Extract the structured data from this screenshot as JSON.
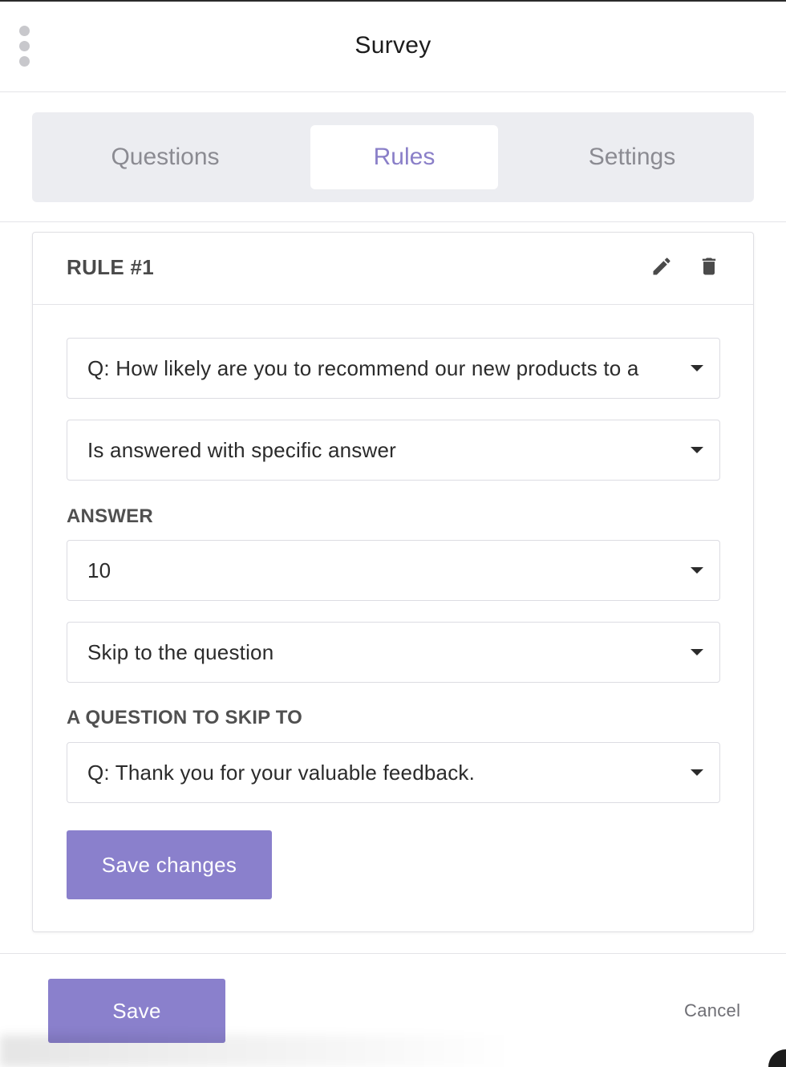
{
  "header": {
    "title": "Survey",
    "menu_icon": "kebab-vertical-icon"
  },
  "tabs": [
    {
      "label": "Questions",
      "active": false
    },
    {
      "label": "Rules",
      "active": true
    },
    {
      "label": "Settings",
      "active": false
    }
  ],
  "rule": {
    "title": "RULE #1",
    "edit_icon": "pencil-icon",
    "delete_icon": "trash-icon",
    "question_select": "Q: How likely are you to recommend our new products to a",
    "condition_select": "Is answered with specific answer",
    "answer_label": "ANSWER",
    "answer_select": "10",
    "action_select": "Skip to the question",
    "skip_to_label": "A QUESTION TO SKIP TO",
    "skip_to_select": "Q: Thank you for your valuable feedback.",
    "save_changes_label": "Save changes"
  },
  "footer": {
    "save_label": "Save",
    "cancel_label": "Cancel"
  },
  "colors": {
    "accent": "#8a80cc",
    "tab_bar_bg": "#ecedf1",
    "active_tab_text": "#8a7fc8"
  }
}
